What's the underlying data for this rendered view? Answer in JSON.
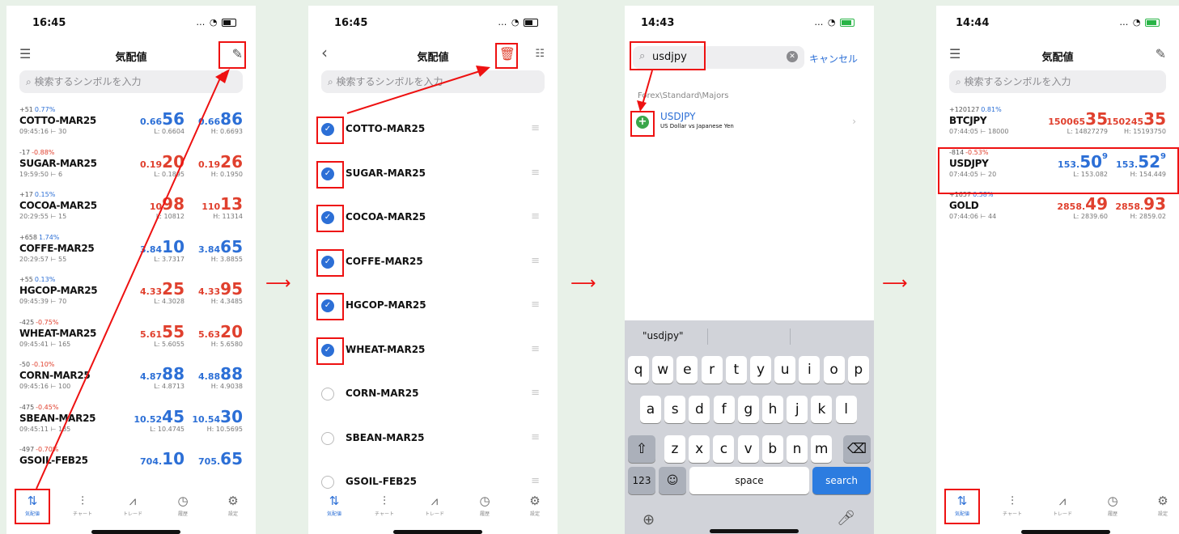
{
  "screens": {
    "s1": {
      "time": "16:45",
      "title": "気配値",
      "search_placeholder": "検索するシンボルを入力",
      "quotes": [
        {
          "chg": "+51",
          "pct": "0.77%",
          "sym": "COTTO-MAR25",
          "tm": "09:45:16",
          "sp": "30",
          "bid_a": "0.66",
          "bid_b": "56",
          "ask_a": "0.66",
          "ask_b": "86",
          "lo": "L: 0.6604",
          "hi": "H: 0.6693",
          "color": "blue"
        },
        {
          "chg": "-17",
          "pct": "-0.88%",
          "sym": "SUGAR-MAR25",
          "tm": "19:59:50",
          "sp": "6",
          "bid_a": "0.19",
          "bid_b": "20",
          "ask_a": "0.19",
          "ask_b": "26",
          "lo": "L: 0.1895",
          "hi": "H: 0.1950",
          "color": "red"
        },
        {
          "chg": "+17",
          "pct": "0.15%",
          "sym": "COCOA-MAR25",
          "tm": "20:29:55",
          "sp": "15",
          "bid_a": "10",
          "bid_b": "98",
          "ask_a": "110",
          "ask_b": "13",
          "lo": "L: 10812",
          "hi": "H: 11314",
          "color": "red"
        },
        {
          "chg": "+658",
          "pct": "1.74%",
          "sym": "COFFE-MAR25",
          "tm": "20:29:57",
          "sp": "55",
          "bid_a": "3.84",
          "bid_b": "10",
          "ask_a": "3.84",
          "ask_b": "65",
          "lo": "L: 3.7317",
          "hi": "H: 3.8855",
          "color": "blue"
        },
        {
          "chg": "+55",
          "pct": "0.13%",
          "sym": "HGCOP-MAR25",
          "tm": "09:45:39",
          "sp": "70",
          "bid_a": "4.33",
          "bid_b": "25",
          "ask_a": "4.33",
          "ask_b": "95",
          "lo": "L: 4.3028",
          "hi": "H: 4.3485",
          "color": "red"
        },
        {
          "chg": "-425",
          "pct": "-0.75%",
          "sym": "WHEAT-MAR25",
          "tm": "09:45:41",
          "sp": "165",
          "bid_a": "5.61",
          "bid_b": "55",
          "ask_a": "5.63",
          "ask_b": "20",
          "lo": "L: 5.6055",
          "hi": "H: 5.6580",
          "color": "red"
        },
        {
          "chg": "-50",
          "pct": "-0.10%",
          "sym": "CORN-MAR25",
          "tm": "09:45:16",
          "sp": "100",
          "bid_a": "4.87",
          "bid_b": "88",
          "ask_a": "4.88",
          "ask_b": "88",
          "lo": "L: 4.8713",
          "hi": "H: 4.9038",
          "color": "blue"
        },
        {
          "chg": "-475",
          "pct": "-0.45%",
          "sym": "SBEAN-MAR25",
          "tm": "09:45:11",
          "sp": "185",
          "bid_a": "10.52",
          "bid_b": "45",
          "ask_a": "10.54",
          "ask_b": "30",
          "lo": "L: 10.4745",
          "hi": "H: 10.5695",
          "color": "blue"
        },
        {
          "chg": "-497",
          "pct": "-0.70%",
          "sym": "GSOIL-FEB25",
          "tm": "",
          "sp": "",
          "bid_a": "704.",
          "bid_b": "10",
          "ask_a": "705.",
          "ask_b": "65",
          "lo": "",
          "hi": "",
          "color": "blue"
        }
      ]
    },
    "s2": {
      "time": "16:45",
      "title": "気配値",
      "search_placeholder": "検索するシンボルを入力",
      "items": [
        {
          "sym": "COTTO-MAR25",
          "checked": true
        },
        {
          "sym": "SUGAR-MAR25",
          "checked": true
        },
        {
          "sym": "COCOA-MAR25",
          "checked": true
        },
        {
          "sym": "COFFE-MAR25",
          "checked": true
        },
        {
          "sym": "HGCOP-MAR25",
          "checked": true
        },
        {
          "sym": "WHEAT-MAR25",
          "checked": true
        },
        {
          "sym": "CORN-MAR25",
          "checked": false
        },
        {
          "sym": "SBEAN-MAR25",
          "checked": false
        },
        {
          "sym": "GSOIL-FEB25",
          "checked": false
        }
      ]
    },
    "s3": {
      "time": "14:43",
      "search_value": "usdjpy",
      "cancel": "キャンセル",
      "path": "Forex\\Standard\\Majors",
      "result_sym": "USDJPY",
      "result_desc": "US Dollar vs Japanese Yen",
      "suggestion": "\"usdjpy\"",
      "row1": [
        "q",
        "w",
        "e",
        "r",
        "t",
        "y",
        "u",
        "i",
        "o",
        "p"
      ],
      "row2": [
        "a",
        "s",
        "d",
        "f",
        "g",
        "h",
        "j",
        "k",
        "l"
      ],
      "row3": [
        "z",
        "x",
        "c",
        "v",
        "b",
        "n",
        "m"
      ],
      "k123": "123",
      "space": "space",
      "search_key": "search"
    },
    "s4": {
      "time": "14:44",
      "title": "気配値",
      "search_placeholder": "検索するシンボルを入力",
      "quotes": [
        {
          "chg": "+120127",
          "pct": "0.81%",
          "sym": "BTCJPY",
          "tm": "07:44:05",
          "sp": "18000",
          "bid_a": "150065",
          "bid_b": "35",
          "ask_a": "150245",
          "ask_b": "35",
          "sup1": "",
          "sup2": "",
          "lo": "L: 14827279",
          "hi": "H: 15193750",
          "color": "red"
        },
        {
          "chg": "-814",
          "pct": "-0.53%",
          "sym": "USDJPY",
          "tm": "07:44:05",
          "sp": "20",
          "bid_a": "153.",
          "bid_b": "50",
          "ask_a": "153.",
          "ask_b": "52",
          "sup1": "9",
          "sup2": "9",
          "lo": "L: 153.082",
          "hi": "H: 154.449",
          "color": "blue"
        },
        {
          "chg": "+1657",
          "pct": "0.58%",
          "sym": "GOLD",
          "tm": "07:44:06",
          "sp": "44",
          "bid_a": "2858.",
          "bid_b": "49",
          "ask_a": "2858.",
          "ask_b": "93",
          "sup1": "",
          "sup2": "",
          "lo": "L: 2839.60",
          "hi": "H: 2859.02",
          "color": "red"
        }
      ]
    }
  },
  "tabbar": [
    {
      "icon": "quotes-icon",
      "label": "気配値"
    },
    {
      "icon": "chart-icon",
      "label": "チャート"
    },
    {
      "icon": "trade-icon",
      "label": "トレード"
    },
    {
      "icon": "history-icon",
      "label": "履歴"
    },
    {
      "icon": "settings-icon",
      "label": "設定"
    }
  ],
  "colors": {
    "highlight": "#e11111",
    "blue": "#2c6fd6",
    "red": "#e0402e",
    "background": "#e8f1e8"
  }
}
